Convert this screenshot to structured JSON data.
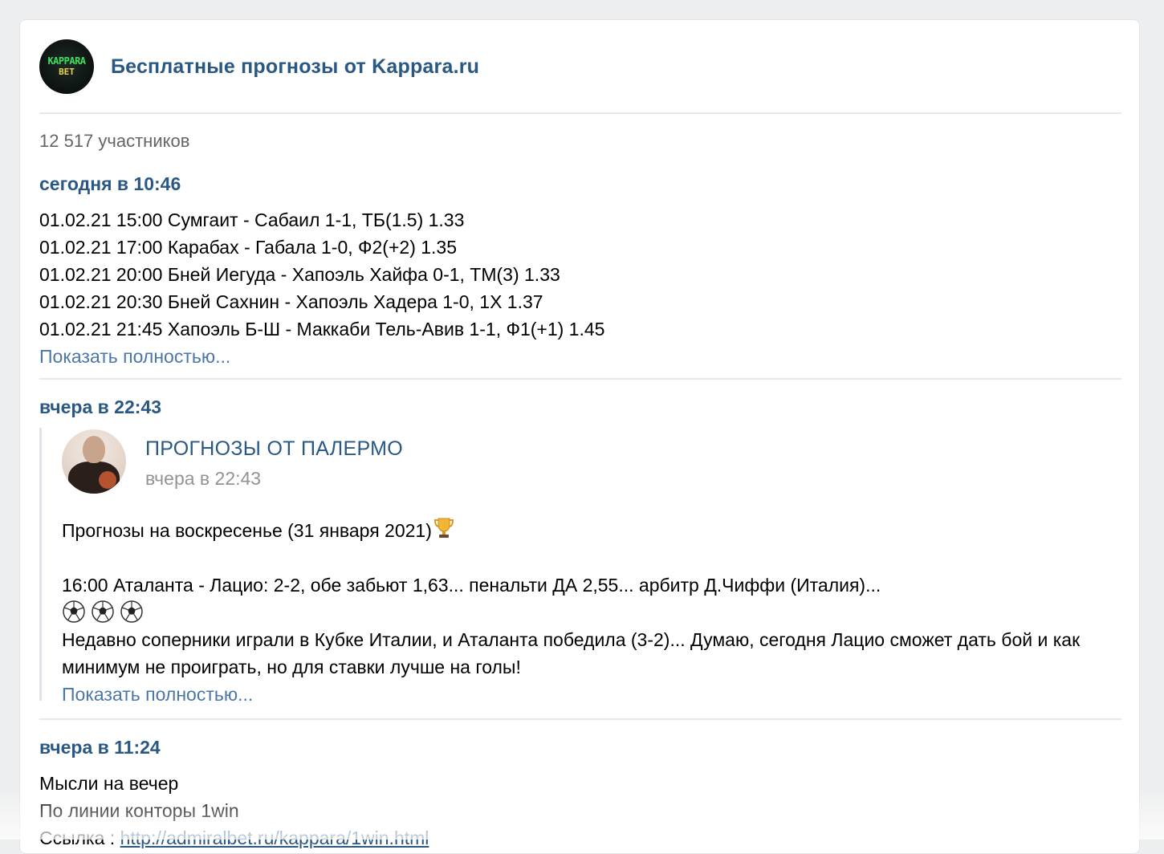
{
  "channel": {
    "logo_text_top": "KAPPARA",
    "logo_text_bottom": "BET",
    "title": "Бесплатные прогнозы от Kappara.ru",
    "members": "12 517 участников"
  },
  "posts": [
    {
      "time": "сегодня в 10:46",
      "lines": [
        "01.02.21 15:00 Сумгаит - Сабаил 1-1, ТБ(1.5) 1.33",
        "01.02.21 17:00 Карабах - Габала 1-0, Ф2(+2) 1.35",
        "01.02.21 20:00 Бней Иегуда - Хапоэль Хайфа 0-1, ТМ(3) 1.33",
        "01.02.21 20:30 Бней Сахнин - Хапоэль Хадера 1-0, 1X 1.37",
        "01.02.21 21:45 Хапоэль Б-Ш - Маккаби Тель-Авив 1-1, Ф1(+1) 1.45"
      ],
      "show_more": "Показать полностью..."
    },
    {
      "time": "вчера в 22:43",
      "repost": {
        "author": "ПРОГНОЗЫ ОТ ПАЛЕРМО",
        "time": "вчера в 22:43",
        "headline": "Прогнозы на воскресенье (31 января 2021)",
        "headline_icon": "trophy-icon",
        "match_line": "16:00 Аталанта - Лацио: 2-2, обе забьют 1,63... пенальти ДА 2,55... арбитр Д.Чиффи (Италия)...",
        "ball_icons": [
          "soccer-ball-icon",
          "soccer-ball-icon",
          "soccer-ball-icon"
        ],
        "body": "Недавно соперники играли в Кубке Италии, и Аталанта победила (3-2)... Думаю, сегодня Лацио сможет дать бой и как минимум не проиграть, но для ставки лучше на голы!",
        "show_more": "Показать полностью..."
      }
    },
    {
      "time": "вчера в 11:24",
      "lines": [
        "Мысли на вечер",
        "По линии конторы 1win"
      ],
      "link_prefix": "Ссылка : ",
      "link_text": "http://admiralbet.ru/kappara/1win.html"
    }
  ],
  "colors": {
    "accent": "#2a5885",
    "link": "#4a76a8",
    "muted": "#939393",
    "background": "#edeeef"
  }
}
